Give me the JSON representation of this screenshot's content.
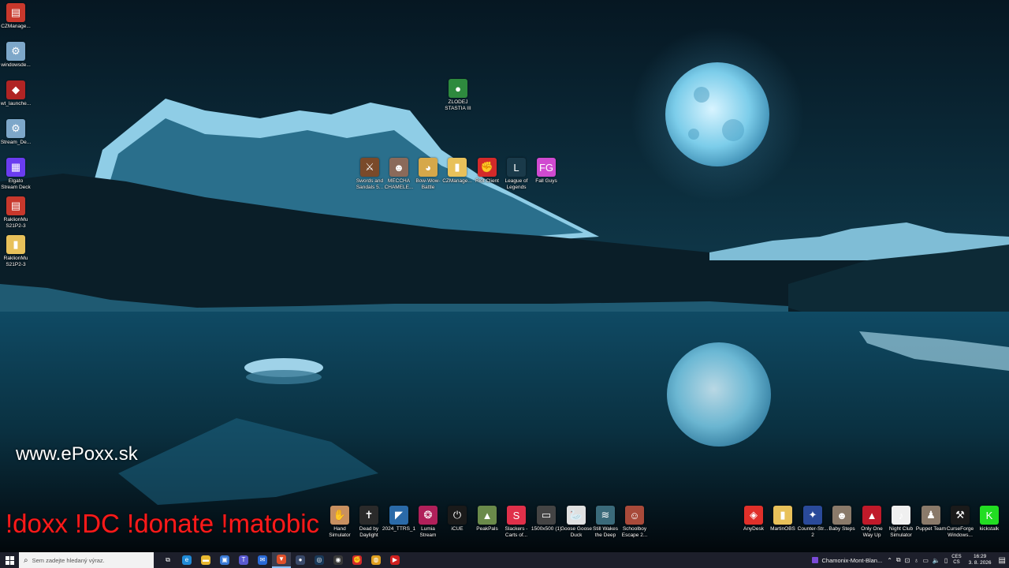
{
  "desktop": {
    "left_icons": [
      {
        "name": "czmanager-archive-icon",
        "label": "CZManage...",
        "color": "#c8382c",
        "glyph": "▤"
      },
      {
        "name": "windowsde-installer-icon",
        "label": "windowsde...",
        "color": "#7da7c9",
        "glyph": "⚙"
      },
      {
        "name": "wt-launcher-icon",
        "label": "wt_launche...",
        "color": "#b02424",
        "glyph": "◆"
      },
      {
        "name": "stream-deck-setup-icon",
        "label": "Stream_De...",
        "color": "#7da7c9",
        "glyph": "⚙"
      },
      {
        "name": "elgato-stream-deck-icon",
        "label": "Elgato\nStream Deck",
        "color": "#6a3cf0",
        "glyph": "▦"
      },
      {
        "name": "raklionmu-archive-icon",
        "label": "RaklionMu\nS21P2-3",
        "color": "#c8382c",
        "glyph": "▤"
      },
      {
        "name": "raklionmu-folder-icon",
        "label": "RaklionMu\nS21P2-3",
        "color": "#e8c15a",
        "glyph": "▮"
      }
    ],
    "middle_icons": [
      {
        "name": "zlodej-stastia-icon",
        "label": "ZLODEJ\nSTASTIA III",
        "color": "#2e8a3e",
        "glyph": "●"
      }
    ],
    "top_row_icons": [
      {
        "name": "swords-and-sandals-icon",
        "label": "Swords and\nSandals 5...",
        "color": "#7a4a2a",
        "glyph": "⚔"
      },
      {
        "name": "meccha-chameleon-icon",
        "label": "MECCHA\nCHAMELE...",
        "color": "#8a6a5a",
        "glyph": "☻"
      },
      {
        "name": "bowwow-battle-icon",
        "label": "Bow-Wow-\nBattle",
        "color": "#d6a84a",
        "glyph": "◕"
      },
      {
        "name": "czmanager-folder-icon",
        "label": "CZManage...",
        "color": "#e8c15a",
        "glyph": "▮"
      },
      {
        "name": "riot-client-icon",
        "label": "Riot Client",
        "color": "#d42a2a",
        "glyph": "✊"
      },
      {
        "name": "league-of-legends-icon",
        "label": "League of\nLegends",
        "color": "#1a3a4a",
        "glyph": "L"
      },
      {
        "name": "fall-guys-icon",
        "label": "Fall Guys",
        "color": "#d04ad0",
        "glyph": "FG"
      }
    ],
    "bottom_row_center": [
      {
        "name": "hand-simulator-icon",
        "label": "Hand\nSimulator",
        "color": "#c89060",
        "glyph": "✋"
      },
      {
        "name": "dead-by-daylight-icon",
        "label": "Dead by\nDaylight",
        "color": "#2a2a2a",
        "glyph": "✝"
      },
      {
        "name": "ttrs-icon",
        "label": "2024_TTRS_1",
        "color": "#2a6aa8",
        "glyph": "◤"
      },
      {
        "name": "lumia-stream-icon",
        "label": "Lumia\nStream",
        "color": "#b0205a",
        "glyph": "❂"
      },
      {
        "name": "icue-icon",
        "label": "iCUE",
        "color": "#1a1a1a",
        "glyph": "⏻"
      },
      {
        "name": "peakpals-icon",
        "label": "PeakPals",
        "color": "#6a8a4a",
        "glyph": "▲"
      },
      {
        "name": "slackers-carts-icon",
        "label": "Slackers -\nCarts of...",
        "color": "#e0304a",
        "glyph": "S"
      },
      {
        "name": "image-file-icon",
        "label": "1500x500 (1)",
        "color": "#444444",
        "glyph": "▭"
      },
      {
        "name": "goose-goose-duck-icon",
        "label": "Goose Goose\nDuck",
        "color": "#e0e0e0",
        "glyph": "🦢"
      },
      {
        "name": "still-wakes-the-deep-icon",
        "label": "Still Wakes\nthe Deep",
        "color": "#3a6a7a",
        "glyph": "≋"
      },
      {
        "name": "schoolboy-escape-icon",
        "label": "Schoolboy\nEscape 2...",
        "color": "#a84a3a",
        "glyph": "☺"
      }
    ],
    "bottom_row_right": [
      {
        "name": "anydesk-icon",
        "label": "AnyDesk",
        "color": "#e0302a",
        "glyph": "◈"
      },
      {
        "name": "martinobs-folder-icon",
        "label": "MartinOBS",
        "color": "#e8c15a",
        "glyph": "▮"
      },
      {
        "name": "counter-strike-icon",
        "label": "Counter-Str...\n2",
        "color": "#2a4a9a",
        "glyph": "✦"
      },
      {
        "name": "baby-steps-icon",
        "label": "Baby Steps",
        "color": "#8a7a6a",
        "glyph": "☻"
      },
      {
        "name": "only-one-way-up-icon",
        "label": "Only One\nWay Up",
        "color": "#c01a2a",
        "glyph": "▲"
      },
      {
        "name": "night-club-simulator-icon",
        "label": "Night Club\nSimulator",
        "color": "#f0f0f0",
        "glyph": "♪"
      },
      {
        "name": "puppet-team-icon",
        "label": "Puppet Team",
        "color": "#8a7a6a",
        "glyph": "♟"
      },
      {
        "name": "curseforge-icon",
        "label": "CurseForge\nWindows...",
        "color": "#1a1a1a",
        "glyph": "⚒"
      },
      {
        "name": "kick-studio-icon",
        "label": "kickstalk",
        "color": "#22dd22",
        "glyph": "K"
      }
    ]
  },
  "overlay": {
    "site": "www.ePoxx.sk",
    "commands": "!doxx  !DC !donate !matobic"
  },
  "taskbar": {
    "search_placeholder": "Sem zadejte hledaný výraz.",
    "media_title": "Chamonix-Mont-Blan...",
    "lang_top": "CES",
    "lang_bottom": "CS",
    "time": "16:29",
    "date": "3. 8. 2026",
    "apps": [
      {
        "name": "task-view-icon",
        "color": "#1d1f2b",
        "glyph": "⧉"
      },
      {
        "name": "edge-icon",
        "color": "#1f8ad6",
        "glyph": "e"
      },
      {
        "name": "file-explorer-icon",
        "color": "#e8b830",
        "glyph": "▬"
      },
      {
        "name": "store-icon",
        "color": "#3a7ad6",
        "glyph": "▣"
      },
      {
        "name": "teams-icon",
        "color": "#5a5ad0",
        "glyph": "T"
      },
      {
        "name": "mail-icon",
        "color": "#2a6ad6",
        "glyph": "✉"
      },
      {
        "name": "brave-icon",
        "color": "#e0502a",
        "glyph": "▼"
      },
      {
        "name": "app-circle-icon",
        "color": "#3a4a6a",
        "glyph": "●"
      },
      {
        "name": "steam-icon",
        "color": "#1a3a5a",
        "glyph": "◎"
      },
      {
        "name": "obs-icon",
        "color": "#3a3a3a",
        "glyph": "◉"
      },
      {
        "name": "riot-taskbar-icon",
        "color": "#d42a2a",
        "glyph": "✊"
      },
      {
        "name": "chrome-icon",
        "color": "#e0a020",
        "glyph": "◍"
      },
      {
        "name": "youtube-icon",
        "color": "#d02020",
        "glyph": "▶"
      }
    ]
  }
}
